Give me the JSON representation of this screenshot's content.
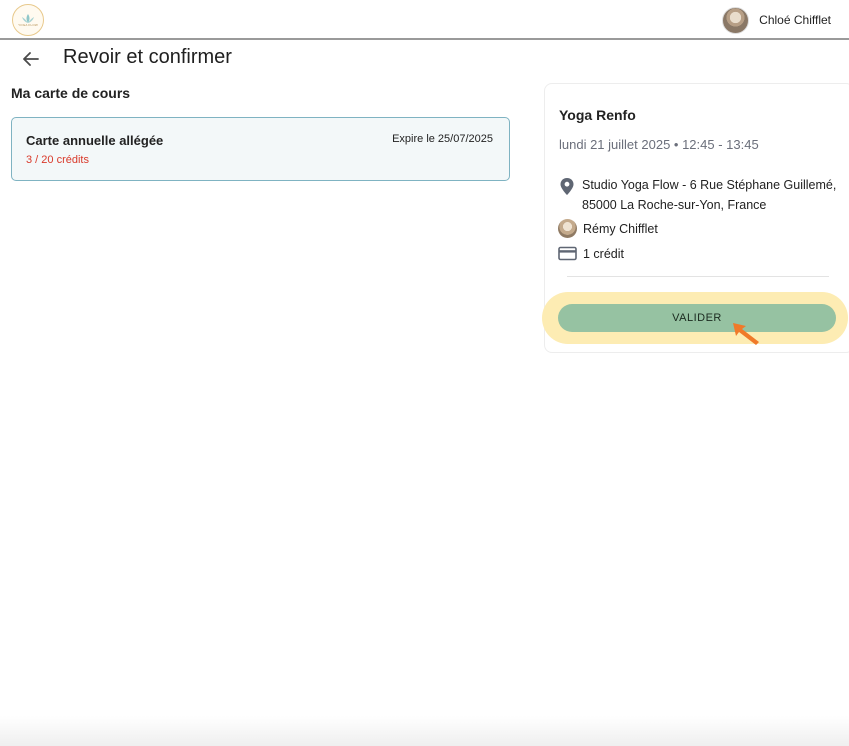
{
  "header": {
    "logo_text": "YOGA FLOW",
    "user_name": "Chloé Chifflet"
  },
  "page": {
    "title": "Revoir et confirmer",
    "section_title": "Ma carte de cours"
  },
  "card": {
    "name": "Carte annuelle allégée",
    "expire": "Expire le 25/07/2025",
    "credits": "3 / 20 crédits"
  },
  "course": {
    "title": "Yoga Renfo",
    "date": "lundi 21 juillet 2025 • 12:45 - 13:45",
    "address": "Studio Yoga Flow - 6 Rue Stéphane Guillemé, 85000 La Roche-sur-Yon, France",
    "teacher": "Rémy Chifflet",
    "cost": "1 crédit",
    "confirm_label": "VALIDER"
  },
  "colors": {
    "accent_button": "#96c2a2",
    "highlight": "#fdecb3",
    "card_border": "#7fb3c2",
    "credits_red": "#d93a2b",
    "cursor_orange": "#f07a2a"
  },
  "icons": {
    "back": "arrow-left-icon",
    "location": "location-pin-icon",
    "credit": "credit-card-icon",
    "pointer": "cursor-arrow-icon"
  }
}
